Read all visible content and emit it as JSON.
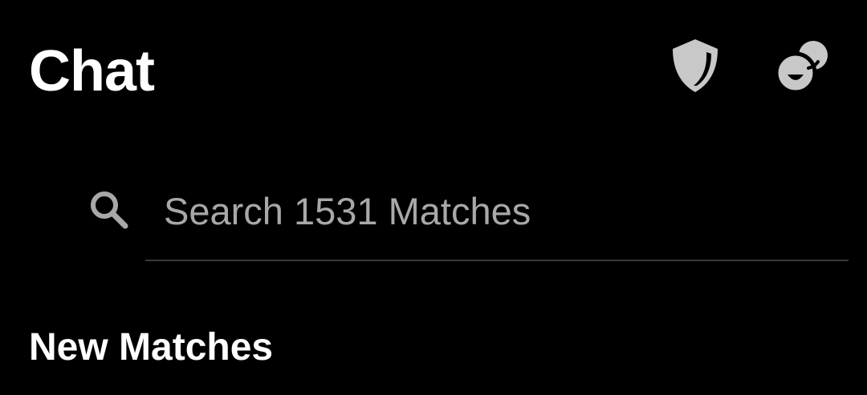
{
  "header": {
    "title": "Chat",
    "icons": {
      "safety": "shield-icon",
      "matches": "matches-bubble-icon"
    },
    "icon_color": "#c8c8c8"
  },
  "search": {
    "placeholder": "Search 1531 Matches",
    "icon": "search-icon",
    "text_color": "#a8a8a8"
  },
  "sections": {
    "new_matches": {
      "title": "New Matches"
    }
  },
  "colors": {
    "background": "#000000",
    "text": "#ffffff",
    "divider": "#3a3a3a"
  }
}
